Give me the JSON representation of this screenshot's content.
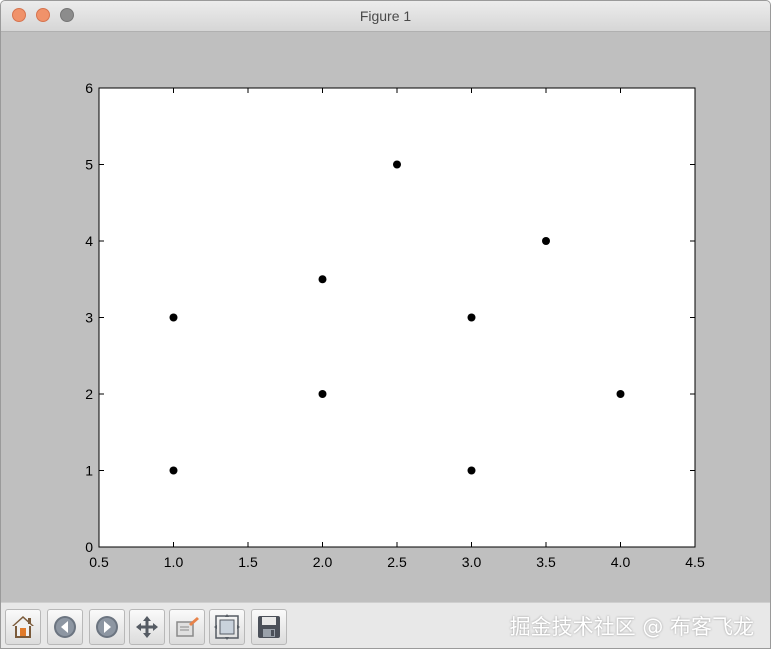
{
  "window": {
    "title": "Figure 1"
  },
  "toolbar": {
    "buttons": [
      {
        "name": "home-button",
        "icon": "home-icon"
      },
      {
        "name": "back-button",
        "icon": "back-arrow-icon"
      },
      {
        "name": "forward-button",
        "icon": "forward-arrow-icon"
      },
      {
        "name": "pan-button",
        "icon": "move-icon"
      },
      {
        "name": "zoom-button",
        "icon": "zoom-rect-icon"
      },
      {
        "name": "subplots-button",
        "icon": "subplots-icon"
      },
      {
        "name": "save-button",
        "icon": "save-icon"
      }
    ],
    "watermark": "掘金技术社区 @ 布客飞龙"
  },
  "chart_data": {
    "type": "scatter",
    "x": [
      1.0,
      1.0,
      2.0,
      2.0,
      2.5,
      3.0,
      3.0,
      3.5,
      4.0
    ],
    "y": [
      1,
      3,
      2,
      3.5,
      5,
      1,
      3,
      4,
      2
    ],
    "xlim": [
      0.5,
      4.5
    ],
    "ylim": [
      0,
      6
    ],
    "xticks": [
      "0.5",
      "1.0",
      "1.5",
      "2.0",
      "2.5",
      "3.0",
      "3.5",
      "4.0",
      "4.5"
    ],
    "yticks": [
      "0",
      "1",
      "2",
      "3",
      "4",
      "5",
      "6"
    ],
    "grid": false,
    "marker_color": "#000000"
  }
}
